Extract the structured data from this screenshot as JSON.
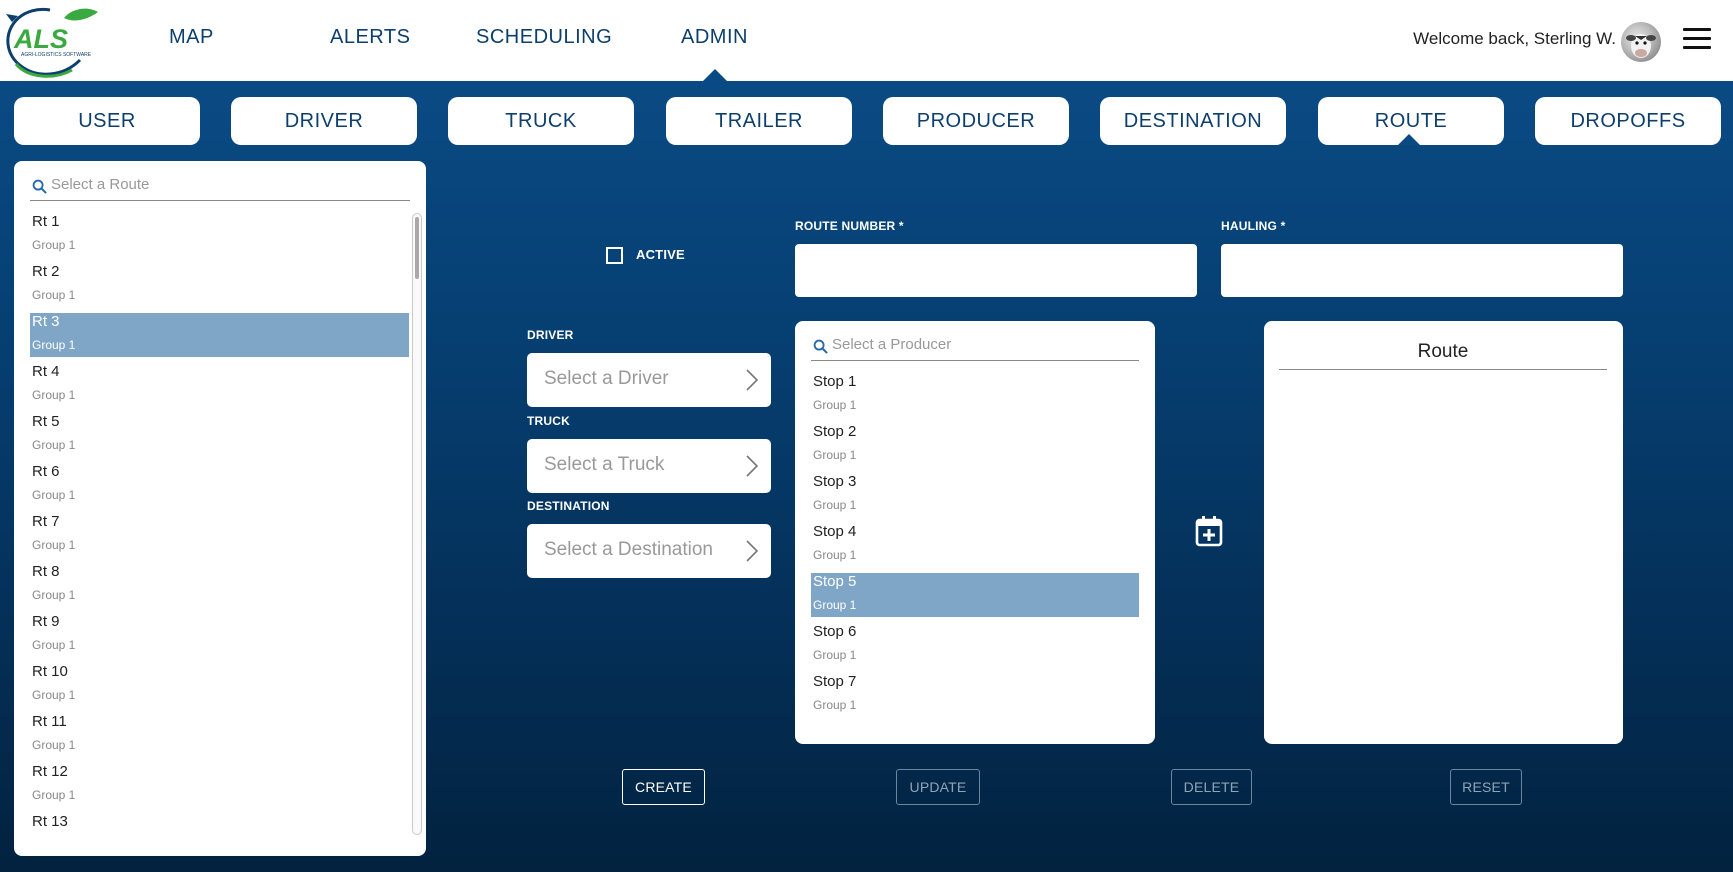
{
  "header": {
    "logo_text": "ALS",
    "logo_subtext": "AGRI-LOGISTICS SOFTWARE",
    "nav": [
      {
        "label": "MAP"
      },
      {
        "label": "ALERTS"
      },
      {
        "label": "SCHEDULING"
      },
      {
        "label": "ADMIN"
      }
    ],
    "active_nav": "ADMIN",
    "welcome": "Welcome back, Sterling W."
  },
  "tabs": [
    {
      "label": "USER"
    },
    {
      "label": "DRIVER"
    },
    {
      "label": "TRUCK"
    },
    {
      "label": "TRAILER"
    },
    {
      "label": "PRODUCER"
    },
    {
      "label": "DESTINATION"
    },
    {
      "label": "ROUTE"
    },
    {
      "label": "DROPOFFS"
    }
  ],
  "active_tab": "ROUTE",
  "route_list": {
    "placeholder": "Select a Route",
    "items": [
      {
        "name": "Rt 1",
        "group": "Group 1"
      },
      {
        "name": "Rt 2",
        "group": "Group 1"
      },
      {
        "name": "Rt 3",
        "group": "Group 1",
        "selected": true
      },
      {
        "name": "Rt 4",
        "group": "Group 1"
      },
      {
        "name": "Rt 5",
        "group": "Group 1"
      },
      {
        "name": "Rt 6",
        "group": "Group 1"
      },
      {
        "name": "Rt 7",
        "group": "Group 1"
      },
      {
        "name": "Rt 8",
        "group": "Group 1"
      },
      {
        "name": "Rt 9",
        "group": "Group 1"
      },
      {
        "name": "Rt 10",
        "group": "Group 1"
      },
      {
        "name": "Rt 11",
        "group": "Group 1"
      },
      {
        "name": "Rt 12",
        "group": "Group 1"
      },
      {
        "name": "Rt 13",
        "group": ""
      }
    ]
  },
  "form": {
    "active_label": "ACTIVE",
    "active_checked": false,
    "route_number_label": "ROUTE NUMBER *",
    "route_number_value": "",
    "hauling_label": "HAULING *",
    "hauling_value": "",
    "driver_label": "DRIVER",
    "driver_placeholder": "Select a Driver",
    "truck_label": "TRUCK",
    "truck_placeholder": "Select a Truck",
    "destination_label": "DESTINATION",
    "destination_placeholder": "Select a Destination"
  },
  "producer_list": {
    "placeholder": "Select a Producer",
    "items": [
      {
        "name": "Stop 1",
        "group": "Group 1"
      },
      {
        "name": "Stop 2",
        "group": "Group 1"
      },
      {
        "name": "Stop 3",
        "group": "Group 1"
      },
      {
        "name": "Stop 4",
        "group": "Group 1"
      },
      {
        "name": "Stop 5",
        "group": "Group 1",
        "selected": true
      },
      {
        "name": "Stop 6",
        "group": "Group 1"
      },
      {
        "name": "Stop 7",
        "group": "Group 1"
      }
    ]
  },
  "route_panel": {
    "title": "Route"
  },
  "buttons": {
    "create": "CREATE",
    "update": "UPDATE",
    "delete": "DELETE",
    "reset": "RESET"
  },
  "colors": {
    "brand_navy": "#0d3f6e",
    "brand_green": "#3aa93f",
    "selection": "#7fa5c7"
  }
}
